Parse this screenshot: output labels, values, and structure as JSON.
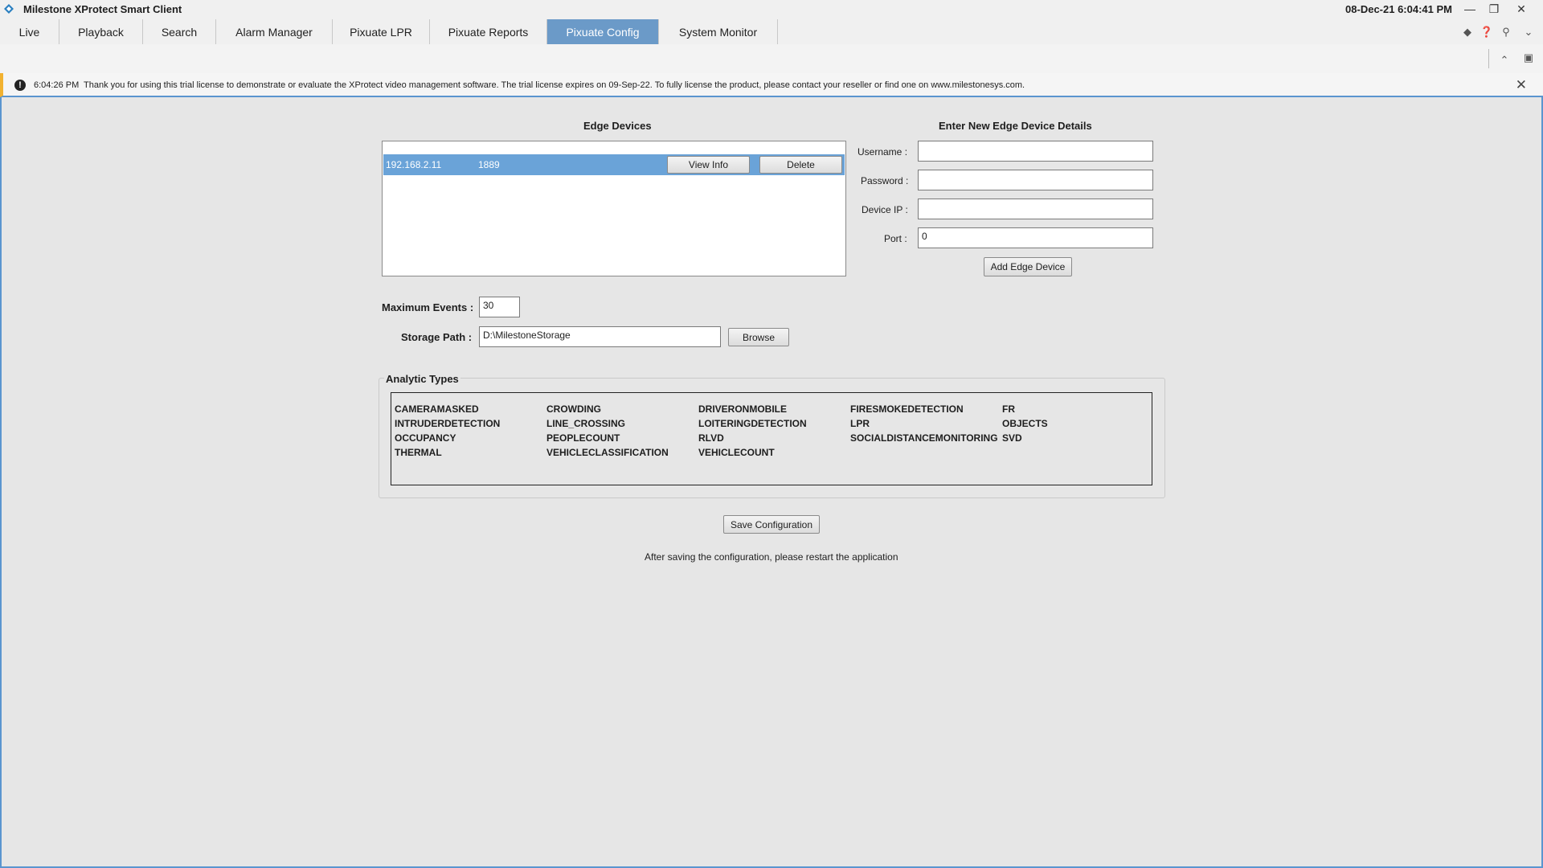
{
  "app": {
    "title": "Milestone XProtect Smart Client",
    "datetime": "08-Dec-21 6:04:41 PM"
  },
  "tabs": [
    "Live",
    "Playback",
    "Search",
    "Alarm Manager",
    "Pixuate LPR",
    "Pixuate Reports",
    "Pixuate Config",
    "System Monitor"
  ],
  "active_tab": "Pixuate Config",
  "notification": {
    "time": "6:04:26 PM",
    "message": "Thank you for using this trial license to demonstrate or evaluate the XProtect video management software. The trial license expires on 09-Sep-22. To fully license the product, please contact your reseller or find one on www.milestonesys.com."
  },
  "edge_devices": {
    "title": "Edge Devices",
    "rows": [
      {
        "ip": "192.168.2.11",
        "port": "1889"
      }
    ],
    "view_info_label": "View Info",
    "delete_label": "Delete"
  },
  "new_device": {
    "title": "Enter New Edge Device Details",
    "username_label": "Username :",
    "password_label": "Password :",
    "device_ip_label": "Device IP :",
    "port_label": "Port :",
    "username_value": "",
    "password_value": "",
    "device_ip_value": "",
    "port_value": "0",
    "add_label": "Add Edge Device"
  },
  "settings": {
    "max_events_label": "Maximum Events :",
    "max_events_value": "30",
    "storage_path_label": "Storage Path :",
    "storage_path_value": "D:\\MilestoneStorage",
    "browse_label": "Browse"
  },
  "analytic_types": {
    "title": "Analytic Types",
    "items": [
      "CAMERAMASKED",
      "CROWDING",
      "DRIVERONMOBILE",
      "FIRESMOKEDETECTION",
      "FR",
      "INTRUDERDETECTION",
      "LINE_CROSSING",
      "LOITERINGDETECTION",
      "LPR",
      "OBJECTS",
      "OCCUPANCY",
      "PEOPLECOUNT",
      "RLVD",
      "SOCIALDISTANCEMONITORING",
      "SVD",
      "THERMAL",
      "VEHICLECLASSIFICATION",
      "VEHICLECOUNT"
    ]
  },
  "save_label": "Save Configuration",
  "restart_note": "After saving the configuration, please restart the application",
  "colors": {
    "active_tab": "#6b9ac8",
    "selected_row": "#6aa3d8",
    "warning_stripe": "#f2b230",
    "frame_border": "#5a95cf"
  }
}
